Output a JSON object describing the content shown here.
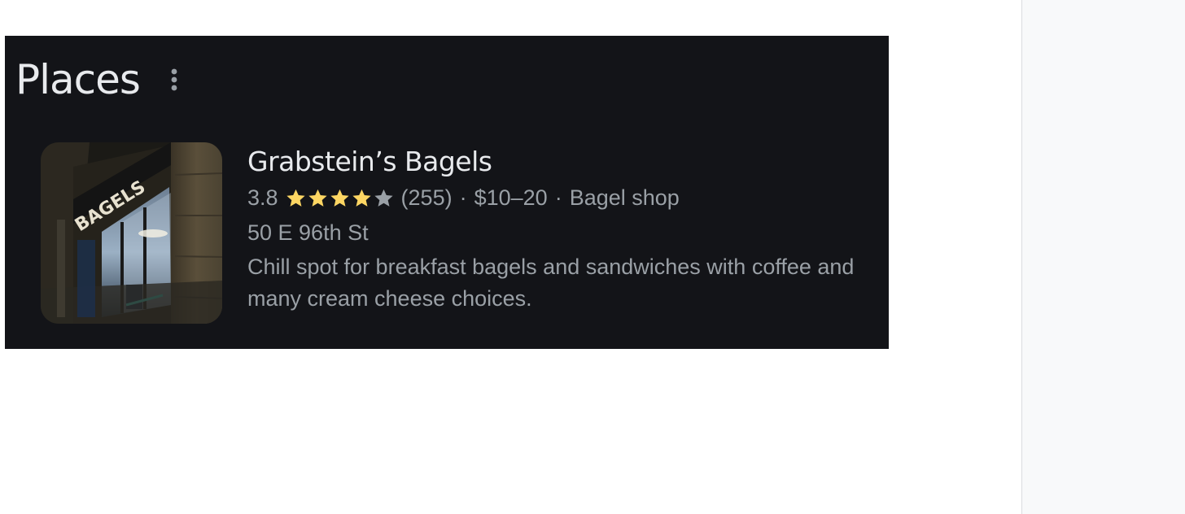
{
  "places": {
    "title": "Places",
    "more_icon": "more-vert-icon",
    "items": [
      {
        "name": "Grabstein’s Bagels",
        "rating": "3.8",
        "rating_value": 3.8,
        "stars_filled": 4,
        "stars_total": 5,
        "reviews": "(255)",
        "price": "$10–20",
        "category": "Bagel shop",
        "separator": "·",
        "address": "50 E 96th St",
        "description": "Chill spot for breakfast bagels and sandwiches with coffee and many cream cheese choices.",
        "thumbnail_sign_text": "BAGELS",
        "colors": {
          "star_filled": "#fdd663",
          "star_empty": "#9aa0a6"
        }
      }
    ]
  }
}
